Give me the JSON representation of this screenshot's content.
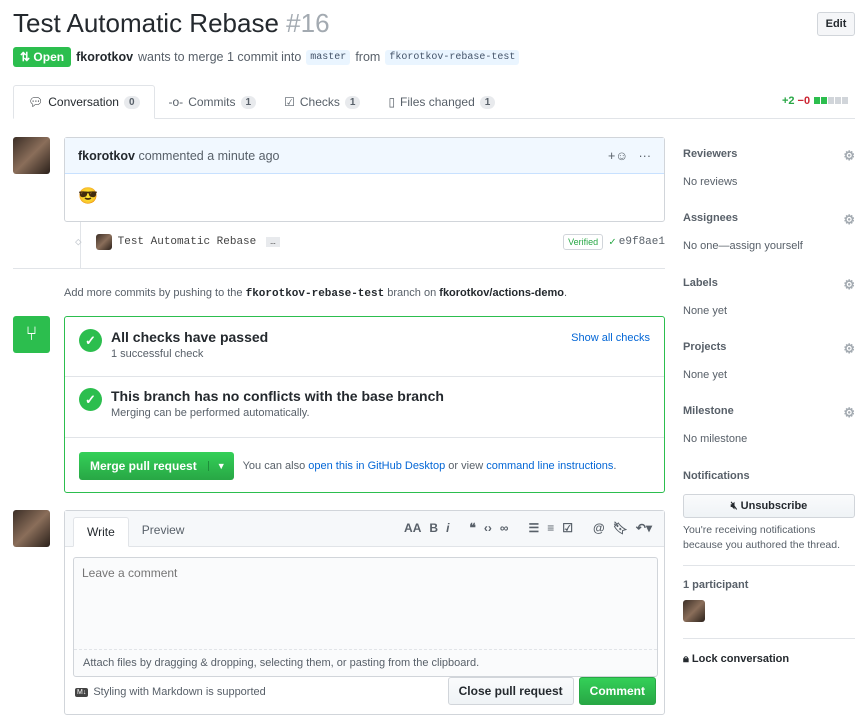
{
  "header": {
    "title": "Test Automatic Rebase",
    "number": "#16",
    "edit_label": "Edit"
  },
  "meta": {
    "state": "Open",
    "author": "fkorotkov",
    "text": "wants to merge 1 commit into",
    "base": "master",
    "from_label": "from",
    "head": "fkorotkov-rebase-test"
  },
  "tabs": [
    {
      "label": "Conversation",
      "count": "0"
    },
    {
      "label": "Commits",
      "count": "1"
    },
    {
      "label": "Checks",
      "count": "1"
    },
    {
      "label": "Files changed",
      "count": "1"
    }
  ],
  "diffstat": {
    "add": "+2",
    "del": "−0"
  },
  "comment": {
    "author": "fkorotkov",
    "action": "commented a minute ago",
    "body": "😎",
    "add_reaction": "+☺",
    "more": "···"
  },
  "commit": {
    "message": "Test Automatic Rebase",
    "ellipsis": "…",
    "verified": "Verified",
    "sha": "e9f8ae1"
  },
  "addmore": {
    "p1": "Add more commits by pushing to the",
    "branch": "fkorotkov-rebase-test",
    "p2": "branch on",
    "repo": "fkorotkov/actions-demo",
    "p3": "."
  },
  "merge": {
    "checks_title": "All checks have passed",
    "checks_sub": "1 successful check",
    "show_all": "Show all checks",
    "conflict_title": "This branch has no conflicts with the base branch",
    "conflict_sub": "Merging can be performed automatically.",
    "merge_button": "Merge pull request",
    "alt1": "You can also",
    "alt_link1": "open this in GitHub Desktop",
    "alt2": "or view",
    "alt_link2": "command line instructions",
    "alt3": "."
  },
  "editor": {
    "tab_write": "Write",
    "tab_preview": "Preview",
    "placeholder": "Leave a comment",
    "attach": "Attach files by dragging & dropping, selecting them, or pasting from the clipboard.",
    "markdown": "Styling with Markdown is supported",
    "close_button": "Close pull request",
    "comment_button": "Comment"
  },
  "sidebar": {
    "reviewers": {
      "title": "Reviewers",
      "value": "No reviews"
    },
    "assignees": {
      "title": "Assignees",
      "value": "No one—assign yourself"
    },
    "labels": {
      "title": "Labels",
      "value": "None yet"
    },
    "projects": {
      "title": "Projects",
      "value": "None yet"
    },
    "milestone": {
      "title": "Milestone",
      "value": "No milestone"
    },
    "notifications": {
      "title": "Notifications",
      "button": "Unsubscribe",
      "text": "You're receiving notifications because you authored the thread."
    },
    "participants": {
      "title": "1 participant"
    },
    "lock": "Lock conversation"
  }
}
